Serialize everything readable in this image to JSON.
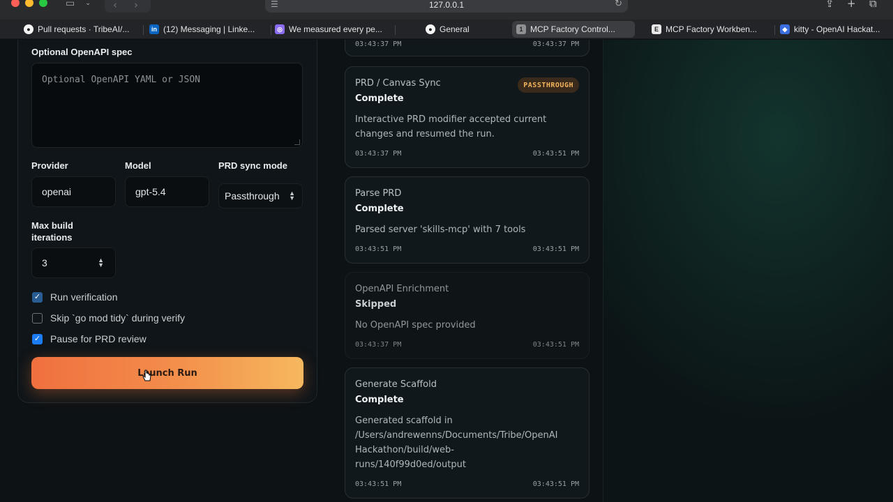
{
  "browser": {
    "address": "127.0.0.1",
    "tabs": [
      {
        "icon": "github-icon",
        "label": "Pull requests · TribeAI/..."
      },
      {
        "icon": "linkedin-icon",
        "label": "(12) Messaging | Linke..."
      },
      {
        "icon": "chat-icon",
        "label": "We measured every pe..."
      },
      {
        "icon": "github-icon",
        "label": "General"
      },
      {
        "icon": "tab-number-icon",
        "label": "MCP Factory Control...",
        "badge": "1"
      },
      {
        "icon": "workbench-icon",
        "label": "MCP Factory Workben...",
        "badge": "E"
      },
      {
        "icon": "kitty-icon",
        "label": "kitty - OpenAI Hackat..."
      }
    ]
  },
  "form": {
    "openapi_label": "Optional OpenAPI spec",
    "openapi_placeholder": "Optional OpenAPI YAML or JSON",
    "provider_label": "Provider",
    "provider_value": "openai",
    "model_label": "Model",
    "model_value": "gpt-5.4",
    "prd_sync_label": "PRD sync mode",
    "prd_sync_value": "Passthrough",
    "max_iter_label_line1": "Max build",
    "max_iter_label_line2": "iterations",
    "max_iter_value": "3",
    "checks": [
      {
        "label": "Run verification",
        "checked": true
      },
      {
        "label": "Skip `go mod tidy` during verify",
        "checked": false
      },
      {
        "label": "Pause for PRD review",
        "checked": true
      }
    ],
    "launch_label": "Launch Run"
  },
  "timeline": {
    "top_partial": {
      "start": "03:43:37 PM",
      "end": "03:43:37 PM"
    },
    "cards": [
      {
        "stage": "PRD / Canvas Sync",
        "status": "Complete",
        "badge": "PASSTHROUGH",
        "message_lines": [
          "Interactive PRD modifier accepted current",
          "changes and resumed the run."
        ],
        "start": "03:43:37 PM",
        "end": "03:43:51 PM"
      },
      {
        "stage": "Parse PRD",
        "status": "Complete",
        "message_lines": [
          "Parsed server 'skills-mcp' with 7 tools"
        ],
        "start": "03:43:51 PM",
        "end": "03:43:51 PM"
      },
      {
        "stage": "OpenAPI Enrichment",
        "status": "Skipped",
        "message_lines": [
          "No OpenAPI spec provided"
        ],
        "start": "03:43:37 PM",
        "end": "03:43:51 PM"
      },
      {
        "stage": "Generate Scaffold",
        "status": "Complete",
        "message_lines": [
          "Generated scaffold in",
          "/Users/andrewenns/Documents/Tribe/OpenAI",
          "Hackathon/build/web-",
          "runs/140f99d0ed/output"
        ],
        "start": "03:43:51 PM",
        "end": "03:43:51 PM"
      }
    ]
  },
  "colors": {
    "accent_start": "#f0703f",
    "accent_end": "#f6b85e",
    "checkbox_blue": "#1c7cf4",
    "badge_text": "#f2b35c"
  }
}
